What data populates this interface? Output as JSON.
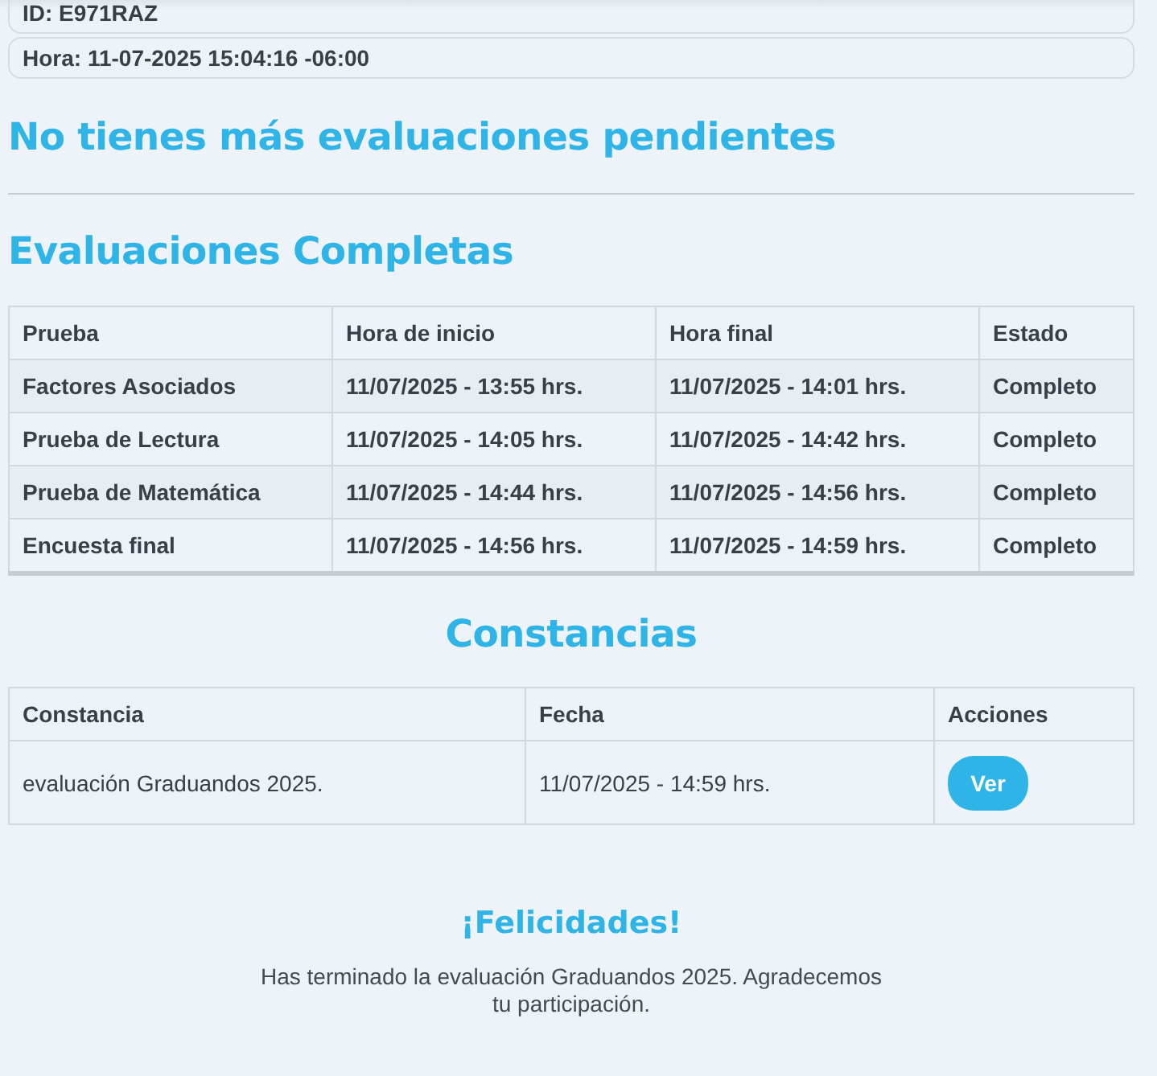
{
  "info": [
    "ID: E971RAZ",
    "Hora: 11-07-2025 15:04:16 -06:00"
  ],
  "pending_heading": "No tienes más evaluaciones pendientes",
  "completed_heading": "Evaluaciones Completas",
  "completed_table": {
    "columns": [
      "Prueba",
      "Hora de inicio",
      "Hora final",
      "Estado"
    ],
    "rows": [
      [
        "Factores Asociados",
        "11/07/2025 - 13:55 hrs.",
        "11/07/2025 - 14:01 hrs.",
        "Completo"
      ],
      [
        "Prueba de Lectura",
        "11/07/2025 - 14:05 hrs.",
        "11/07/2025 - 14:42 hrs.",
        "Completo"
      ],
      [
        "Prueba de Matemática",
        "11/07/2025 - 14:44 hrs.",
        "11/07/2025 - 14:56 hrs.",
        "Completo"
      ],
      [
        "Encuesta final",
        "11/07/2025 - 14:56 hrs.",
        "11/07/2025 - 14:59 hrs.",
        "Completo"
      ]
    ]
  },
  "certificates_heading": "Constancias",
  "certificates_table": {
    "columns": [
      "Constancia",
      "Fecha",
      "Acciones"
    ],
    "rows": [
      {
        "name": "evaluación Graduandos 2025.",
        "date": "11/07/2025 - 14:59 hrs.",
        "action": "Ver"
      }
    ]
  },
  "congrats_title": "¡Felicidades!",
  "congrats_message": "Has terminado la evaluación Graduandos 2025. Agradecemos tu participación."
}
